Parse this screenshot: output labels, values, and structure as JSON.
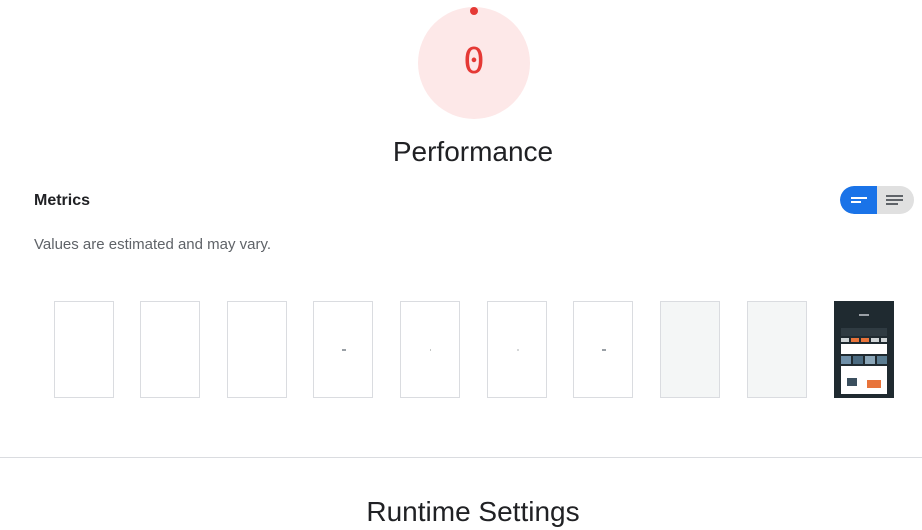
{
  "score": {
    "value": "0",
    "label": "Performance",
    "color": "#e53935",
    "background": "#fde8e8"
  },
  "metrics": {
    "heading": "Metrics",
    "note": "Values are estimated and may vary.",
    "view_toggle": {
      "options": [
        "bars-icon",
        "lines-icon"
      ],
      "selected": "bars-icon",
      "accent": "#1a73e8"
    }
  },
  "filmstrip": {
    "frames": [
      {
        "state": "blank"
      },
      {
        "state": "blank"
      },
      {
        "state": "blank"
      },
      {
        "state": "loading"
      },
      {
        "state": "loading"
      },
      {
        "state": "loading"
      },
      {
        "state": "loading"
      },
      {
        "state": "background"
      },
      {
        "state": "background"
      },
      {
        "state": "rendered"
      }
    ]
  },
  "runtime": {
    "title": "Runtime Settings"
  }
}
